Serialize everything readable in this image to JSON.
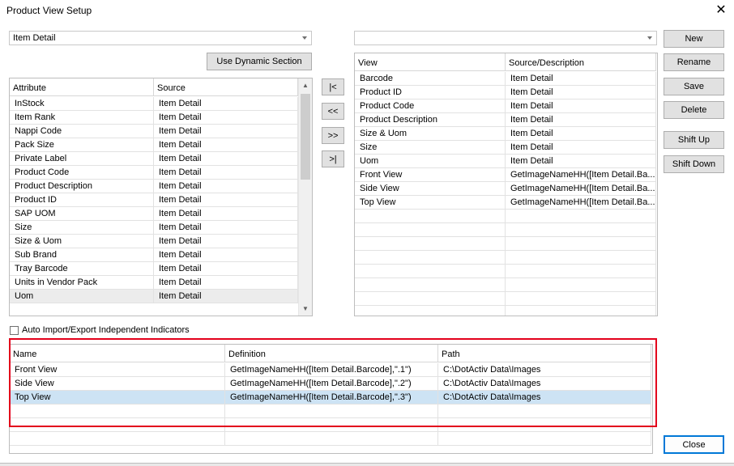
{
  "window": {
    "title": "Product View Setup",
    "close_glyph": "✕"
  },
  "section_combo": {
    "value": "Item Detail"
  },
  "view_combo": {
    "value": ""
  },
  "buttons": {
    "use_dynamic": "Use Dynamic Section",
    "move_first": "|<",
    "move_left": "<<",
    "move_right": ">>",
    "move_last": ">|",
    "new": "New",
    "rename": "Rename",
    "save": "Save",
    "delete": "Delete",
    "shift_up": "Shift Up",
    "shift_down": "Shift Down",
    "close": "Close"
  },
  "attributes": {
    "headers": [
      "Attribute",
      "Source"
    ],
    "rows": [
      [
        "InStock",
        "Item Detail"
      ],
      [
        "Item Rank",
        "Item Detail"
      ],
      [
        "Nappi Code",
        "Item Detail"
      ],
      [
        "Pack Size",
        "Item Detail"
      ],
      [
        "Private Label",
        "Item Detail"
      ],
      [
        "Product Code",
        "Item Detail"
      ],
      [
        "Product Description",
        "Item Detail"
      ],
      [
        "Product ID",
        "Item Detail"
      ],
      [
        "SAP UOM",
        "Item Detail"
      ],
      [
        "Size",
        "Item Detail"
      ],
      [
        "Size & Uom",
        "Item Detail"
      ],
      [
        "Sub Brand",
        "Item Detail"
      ],
      [
        "Tray Barcode",
        "Item Detail"
      ],
      [
        "Units in Vendor Pack",
        "Item Detail"
      ],
      [
        "Uom",
        "Item Detail"
      ]
    ]
  },
  "views": {
    "headers": [
      "View",
      "Source/Description"
    ],
    "rows": [
      [
        "Barcode",
        "Item Detail"
      ],
      [
        "Product ID",
        "Item Detail"
      ],
      [
        "Product Code",
        "Item Detail"
      ],
      [
        "Product Description",
        "Item Detail"
      ],
      [
        "Size & Uom",
        "Item Detail"
      ],
      [
        "Size",
        "Item Detail"
      ],
      [
        "Uom",
        "Item Detail"
      ],
      [
        "Front View",
        "GetImageNameHH([Item Detail.Ba..."
      ],
      [
        "Side View",
        "GetImageNameHH([Item Detail.Ba..."
      ],
      [
        "Top View",
        "GetImageNameHH([Item Detail.Ba..."
      ]
    ]
  },
  "auto_import": {
    "label": "Auto Import/Export Independent Indicators",
    "checked": false
  },
  "definitions": {
    "headers": [
      "Name",
      "Definition",
      "Path"
    ],
    "rows": [
      [
        "Front View",
        "GetImageNameHH([Item Detail.Barcode],\".1\")",
        "C:\\DotActiv Data\\Images"
      ],
      [
        "Side View",
        "GetImageNameHH([Item Detail.Barcode],\".2\")",
        "C:\\DotActiv Data\\Images"
      ],
      [
        "Top View",
        "GetImageNameHH([Item Detail.Barcode],\".3\")",
        "C:\\DotActiv Data\\Images"
      ]
    ]
  },
  "icons": {
    "close": "close-icon",
    "dropdown": "chevron-down-icon",
    "scroll_up": "arrow-up-icon",
    "scroll_down": "arrow-down-icon"
  },
  "colors": {
    "highlight": "#e3001b",
    "selected_row": "#cde3f4",
    "accent": "#0078d7"
  }
}
